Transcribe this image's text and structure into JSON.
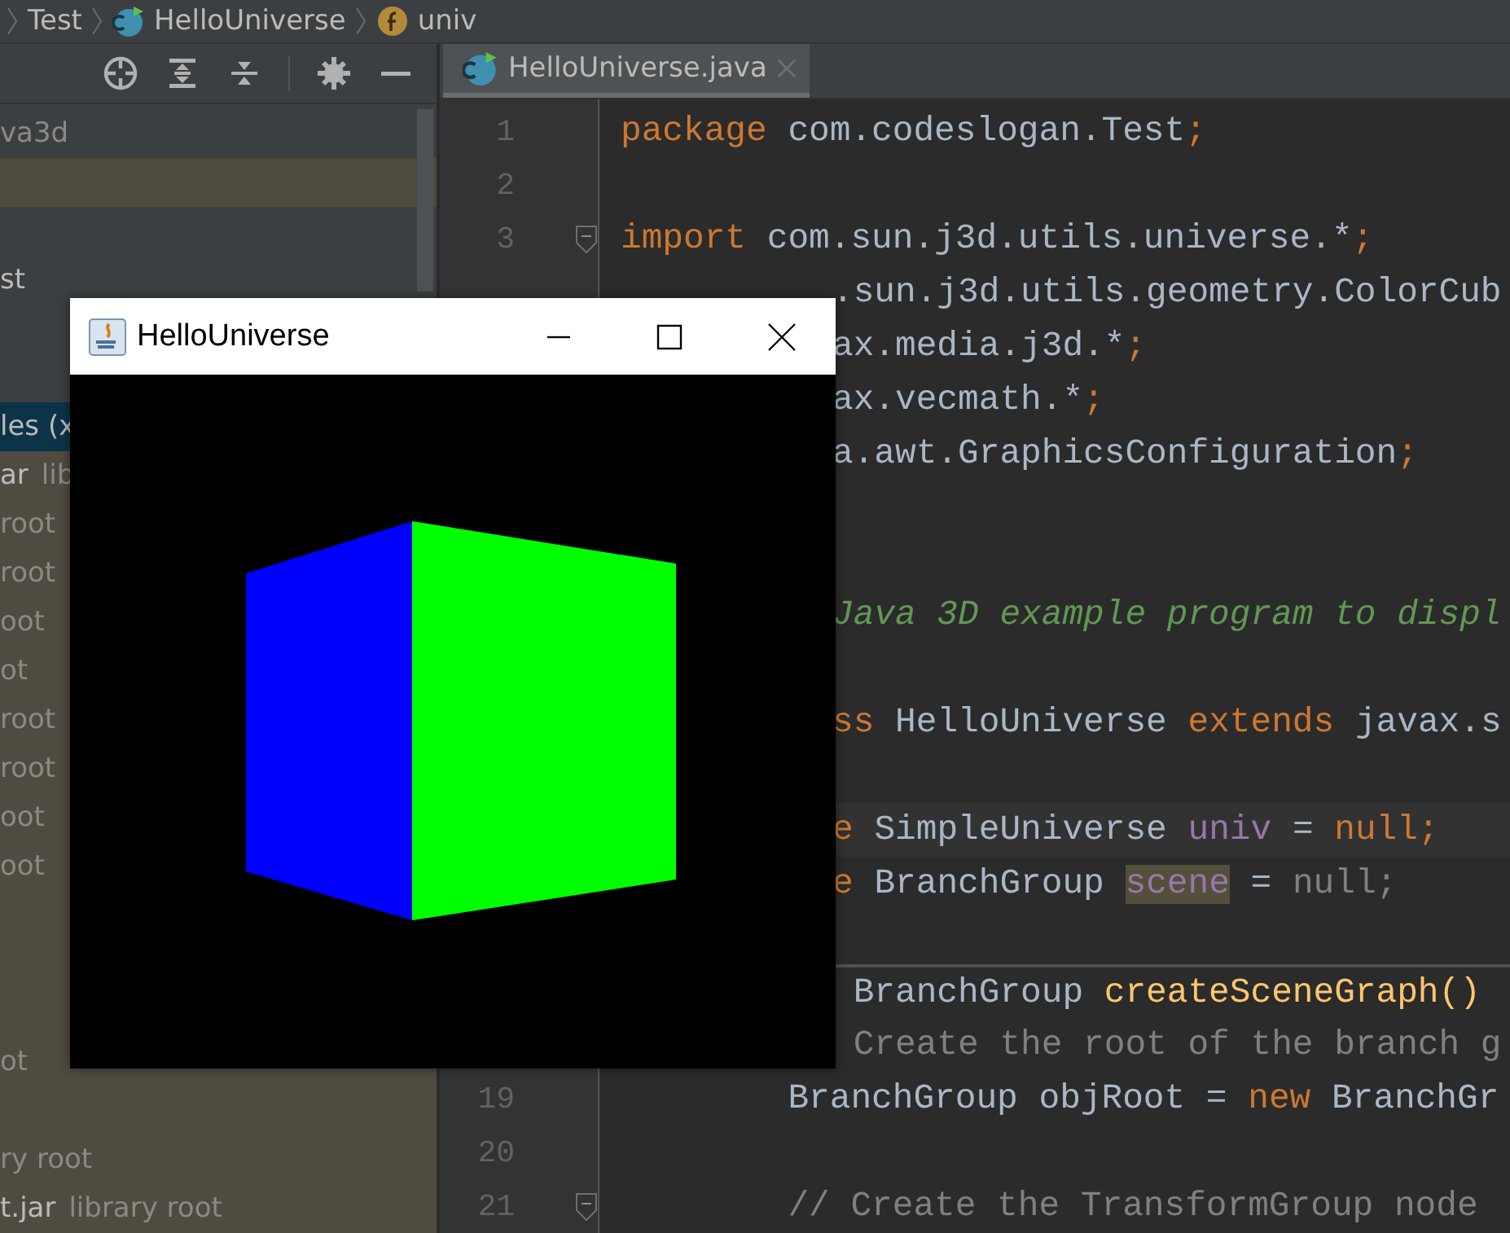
{
  "breadcrumb": [
    {
      "label": "Test",
      "kind": "package"
    },
    {
      "label": "HelloUniverse",
      "kind": "class"
    },
    {
      "label": "univ",
      "kind": "field"
    }
  ],
  "project_tree": [
    {
      "secondary": "va3d",
      "selected": false,
      "kind": "module"
    },
    {
      "selected": false,
      "kind": "highlighted"
    },
    {
      "selected": false,
      "kind": "module"
    },
    {
      "primary": "st",
      "selected": false,
      "kind": "module"
    },
    {
      "selected": false,
      "kind": "module"
    },
    {
      "selected": false,
      "kind": "module"
    },
    {
      "primary": "les (x",
      "selected": true,
      "kind": "library"
    },
    {
      "primary": "ar",
      "secondary": "lib",
      "selected": false,
      "kind": "library"
    },
    {
      "secondary": "root",
      "selected": false,
      "kind": "library"
    },
    {
      "secondary": "root",
      "selected": false,
      "kind": "library"
    },
    {
      "secondary": "oot",
      "selected": false,
      "kind": "library"
    },
    {
      "secondary": "ot",
      "selected": false,
      "kind": "library"
    },
    {
      "secondary": "root",
      "selected": false,
      "kind": "library"
    },
    {
      "secondary": "root",
      "selected": false,
      "kind": "library"
    },
    {
      "secondary": "oot",
      "selected": false,
      "kind": "library"
    },
    {
      "secondary": "oot",
      "selected": false,
      "kind": "library"
    },
    {
      "selected": false,
      "kind": "library"
    },
    {
      "selected": false,
      "kind": "library"
    },
    {
      "selected": false,
      "kind": "library"
    },
    {
      "secondary": "ot",
      "selected": false,
      "kind": "library"
    },
    {
      "selected": false,
      "kind": "library"
    },
    {
      "secondary": "ry root",
      "selected": false,
      "kind": "library"
    },
    {
      "primary": "t.jar",
      "secondary": "library root",
      "selected": false,
      "kind": "library"
    }
  ],
  "editor_tabs": [
    {
      "label": "HelloUniverse.java",
      "selected": true
    }
  ],
  "code_lines": [
    {
      "kind": "plain",
      "number": "1",
      "tokens": [
        {
          "kind": "keyword",
          "text": "package "
        },
        {
          "kind": "plain",
          "text": "com.codeslogan.Test"
        },
        {
          "kind": "keyword",
          "text": ";"
        }
      ]
    },
    {
      "kind": "plain",
      "number": "2"
    },
    {
      "kind": "folding",
      "number": "3",
      "tokens": [
        {
          "kind": "keyword",
          "text": "import "
        },
        {
          "kind": "plain",
          "text": "com.sun.j3d.utils.universe.*"
        },
        {
          "kind": "keyword",
          "text": ";"
        }
      ]
    },
    {
      "kind": "covered",
      "tokens": [
        {
          "kind": "plain",
          "text": ".sun.j3d.utils.geometry.ColorCub"
        }
      ]
    },
    {
      "kind": "covered",
      "tokens": [
        {
          "kind": "plain",
          "text": "ax.media.j3d.*"
        },
        {
          "kind": "keyword",
          "text": ";"
        }
      ]
    },
    {
      "kind": "covered",
      "tokens": [
        {
          "kind": "plain",
          "text": "ax.vecmath.*"
        },
        {
          "kind": "keyword",
          "text": ";"
        }
      ]
    },
    {
      "kind": "covered",
      "tokens": [
        {
          "kind": "plain",
          "text": "a.awt.GraphicsConfiguration"
        },
        {
          "kind": "keyword",
          "text": ";"
        }
      ]
    },
    {
      "kind": "covered"
    },
    {
      "kind": "covered"
    },
    {
      "kind": "covered",
      "tokens": [
        {
          "kind": "comment",
          "text": "Java 3D example program to displ"
        }
      ]
    },
    {
      "kind": "covered"
    },
    {
      "kind": "covered",
      "tokens": [
        {
          "kind": "keyword",
          "text": "ss "
        },
        {
          "kind": "plain",
          "text": "HelloUniverse "
        },
        {
          "kind": "keyword",
          "text": "extends "
        },
        {
          "kind": "plain",
          "text": "javax.s"
        }
      ]
    },
    {
      "kind": "covered"
    },
    {
      "kind": "caret",
      "tokens": [
        {
          "kind": "keyword",
          "text": "e "
        },
        {
          "kind": "plain",
          "text": "SimpleUniverse "
        },
        {
          "kind": "field",
          "text": "univ"
        },
        {
          "kind": "plain",
          "text": " = "
        },
        {
          "kind": "keyword",
          "text": "null;"
        }
      ]
    },
    {
      "kind": "covered",
      "tokens": [
        {
          "kind": "keyword",
          "text": "e "
        },
        {
          "kind": "plain",
          "text": "BranchGroup "
        },
        {
          "kind": "match",
          "text": "scene"
        },
        {
          "kind": "plain",
          "text": " = "
        },
        {
          "kind": "unused",
          "text": "null;"
        }
      ]
    },
    {
      "kind": "covered"
    },
    {
      "kind": "method",
      "tokens": [
        {
          "kind": "plain",
          "text": " BranchGroup "
        },
        {
          "kind": "method",
          "text": "createSceneGraph()"
        }
      ]
    },
    {
      "kind": "covered",
      "tokens": [
        {
          "kind": "doc",
          "text": " Create the root of the branch g"
        }
      ]
    },
    {
      "kind": "plain",
      "number": "19",
      "tokens": [
        {
          "kind": "plain",
          "text": "        BranchGroup objRoot = "
        },
        {
          "kind": "keyword",
          "text": "new "
        },
        {
          "kind": "plain",
          "text": "BranchGr"
        }
      ]
    },
    {
      "kind": "plain",
      "number": "20"
    },
    {
      "kind": "folding",
      "number": "21",
      "tokens": [
        {
          "kind": "doc",
          "text": "        // Create the TransformGroup node"
        }
      ]
    }
  ],
  "app_window": {
    "title": "HelloUniverse"
  }
}
